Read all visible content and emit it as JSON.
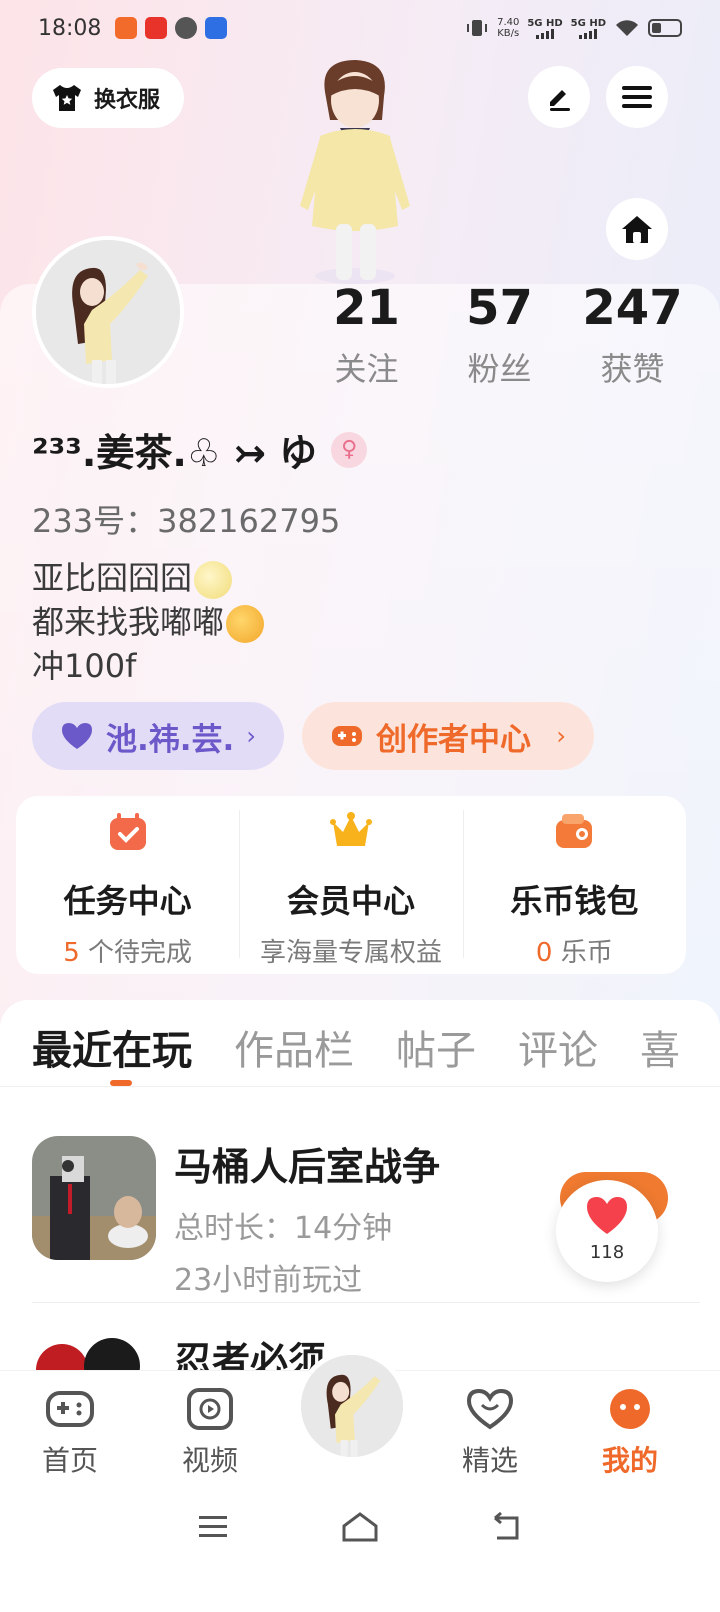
{
  "status_bar": {
    "time": "18:08",
    "net_speed": "7.40",
    "net_unit": "KB/s",
    "sig1": "5G HD",
    "sig2": "5G HD",
    "battery_level": 0.35
  },
  "header": {
    "dress_label": "换衣服"
  },
  "profile": {
    "name": "²³³.姜茶.♧ ↣ ゆ",
    "gender_icon": "♀",
    "uid": "233号：382162795",
    "bio": [
      "亚比囧囧囧",
      "都来找我嘟嘟",
      "冲100f"
    ],
    "stats": [
      {
        "num": "21",
        "label": "关注"
      },
      {
        "num": "57",
        "label": "粉丝"
      },
      {
        "num": "247",
        "label": "获赞"
      }
    ],
    "pill_cp": "池.祎.芸.",
    "pill_creator": "创作者中心",
    "arrow": "›"
  },
  "center": {
    "task_title": "任务中心",
    "task_count": "5",
    "task_suffix": " 个待完成",
    "vip_title": "会员中心",
    "vip_sub": "享海量专属权益",
    "wallet_title": "乐币钱包",
    "wallet_count": "0",
    "wallet_suffix": " 乐币"
  },
  "tabs": [
    "最近在玩",
    "作品栏",
    "帖子",
    "评论",
    "喜"
  ],
  "games": [
    {
      "title": "马桶人后室战争",
      "duration": "总时长：14分钟",
      "last": "23小时前玩过"
    },
    {
      "title": "忍者必须"
    }
  ],
  "like_count": "118",
  "nav": {
    "home": "首页",
    "video": "视频",
    "featured": "精选",
    "mine": "我的"
  },
  "colors": {
    "accent": "#ef6a2a",
    "purple": "#6c59c9"
  }
}
